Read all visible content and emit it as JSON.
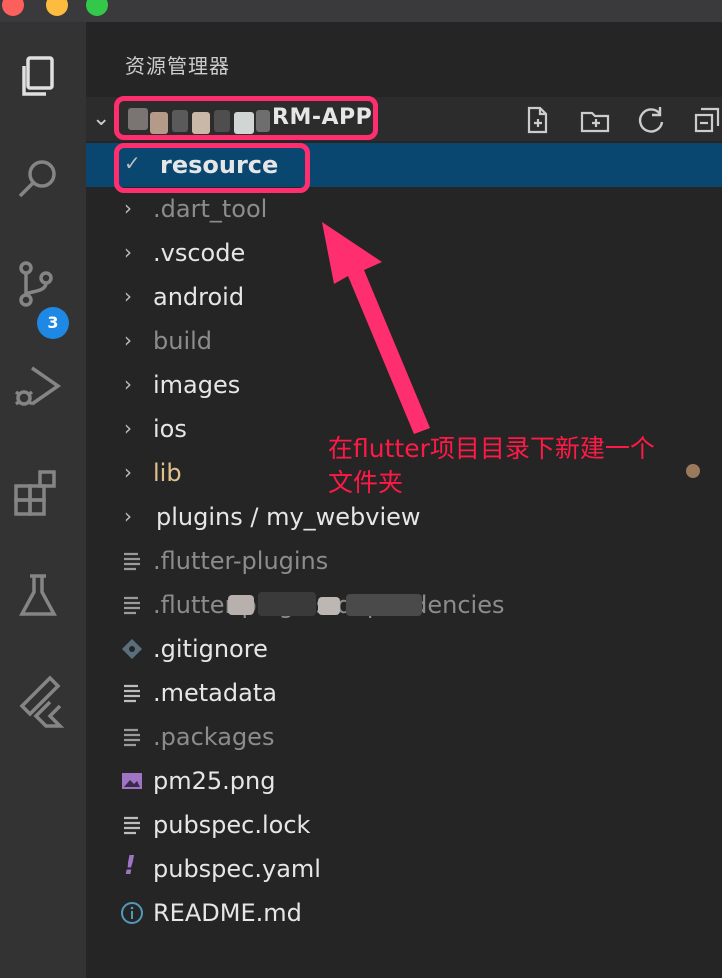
{
  "window": {
    "controls": [
      "close",
      "minimize",
      "zoom"
    ]
  },
  "activity_bar": {
    "items": [
      {
        "name": "explorer-icon",
        "active": true
      },
      {
        "name": "search-icon",
        "active": false
      },
      {
        "name": "source-control-icon",
        "active": false
      },
      {
        "name": "run-debug-icon",
        "active": false
      },
      {
        "name": "extensions-icon",
        "active": false
      },
      {
        "name": "testing-icon",
        "active": false
      },
      {
        "name": "flutter-icon",
        "active": false
      }
    ],
    "source_control_badge": "3"
  },
  "explorer": {
    "title": "资源管理器",
    "project_name": "RM-APP",
    "toolbar": [
      "new-file-icon",
      "new-folder-icon",
      "refresh-icon",
      "collapse-all-icon"
    ],
    "tree": [
      {
        "label": "resource",
        "type": "folder-open",
        "selected": true
      },
      {
        "label": ".dart_tool",
        "type": "folder",
        "dim": true
      },
      {
        "label": ".vscode",
        "type": "folder"
      },
      {
        "label": "android",
        "type": "folder"
      },
      {
        "label": "build",
        "type": "folder",
        "dim": true
      },
      {
        "label": "images",
        "type": "folder"
      },
      {
        "label": "ios",
        "type": "folder"
      },
      {
        "label": "lib",
        "type": "folder",
        "color": "yellow"
      },
      {
        "label": "plugins / my_webview",
        "type": "folder"
      },
      {
        "label": ".flutter-plugins",
        "type": "file",
        "dim": true
      },
      {
        "label": ".flutter-plugins-dependencies",
        "type": "file",
        "dim": true
      },
      {
        "label": ".gitignore",
        "type": "git"
      },
      {
        "label": ".metadata",
        "type": "file"
      },
      {
        "label": ".packages",
        "type": "file",
        "dim": true
      },
      {
        "label": "pm25.png",
        "type": "image"
      },
      {
        "label": "pubspec.lock",
        "type": "file"
      },
      {
        "label": "pubspec.yaml",
        "type": "yaml"
      },
      {
        "label": "README.md",
        "type": "info"
      }
    ]
  },
  "annotation": {
    "line1": "在flutter项目目录下新建一个",
    "line2": "文件夹",
    "color": "#ff1a45"
  }
}
